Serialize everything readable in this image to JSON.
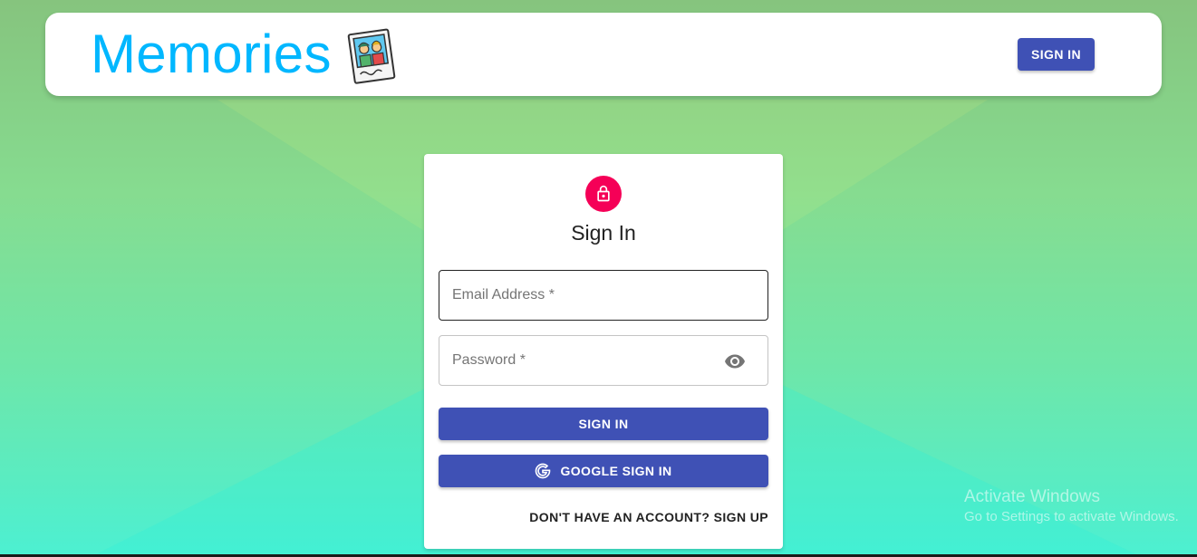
{
  "appbar": {
    "brand_title": "Memories",
    "logo_icon": "polaroid-photo-icon",
    "signin_label": "SIGN IN"
  },
  "auth_card": {
    "icon": "lock-icon",
    "title": "Sign In",
    "email_placeholder": "Email Address *",
    "email_value": "",
    "password_placeholder": "Password *",
    "password_value": "",
    "password_toggle_icon": "eye-icon",
    "signin_label": "SIGN IN",
    "google_label": "GOOGLE SIGN IN",
    "google_icon": "google-g-icon",
    "switch_label": "DON'T HAVE AN ACCOUNT? SIGN UP"
  },
  "watermark": {
    "line1": "Activate Windows",
    "line2": "Go to Settings to activate Windows."
  },
  "colors": {
    "brand": "#00b7ff",
    "primary": "#3f51b5",
    "avatar": "#f50057",
    "gradient_top": "#86c47e",
    "gradient_bottom": "#4cf0d2"
  }
}
